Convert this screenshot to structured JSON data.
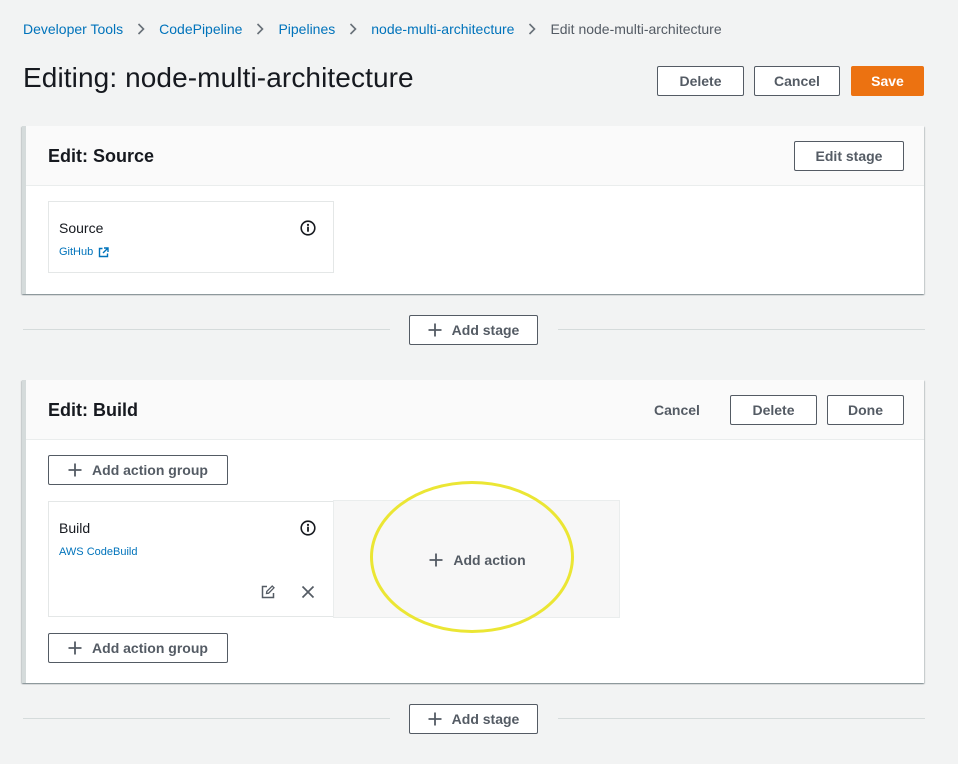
{
  "breadcrumb": {
    "items": [
      "Developer Tools",
      "CodePipeline",
      "Pipelines",
      "node-multi-architecture"
    ],
    "current": "Edit node-multi-architecture"
  },
  "page": {
    "title": "Editing: node-multi-architecture",
    "delete_label": "Delete",
    "cancel_label": "Cancel",
    "save_label": "Save"
  },
  "source_stage": {
    "title": "Edit: Source",
    "edit_stage_label": "Edit stage",
    "action": {
      "name": "Source",
      "provider": "GitHub"
    }
  },
  "add_stage_label": "Add stage",
  "build_stage": {
    "title": "Edit: Build",
    "cancel_label": "Cancel",
    "delete_label": "Delete",
    "done_label": "Done",
    "add_action_group_label": "Add action group",
    "action": {
      "name": "Build",
      "provider": "AWS CodeBuild"
    },
    "add_action_label": "Add action"
  },
  "colors": {
    "link": "#0073bb",
    "primary": "#ec7211",
    "highlight": "#ebe634"
  },
  "icons": [
    "chevron-right-icon",
    "external-link-icon",
    "info-icon",
    "plus-icon",
    "edit-icon",
    "close-icon"
  ]
}
